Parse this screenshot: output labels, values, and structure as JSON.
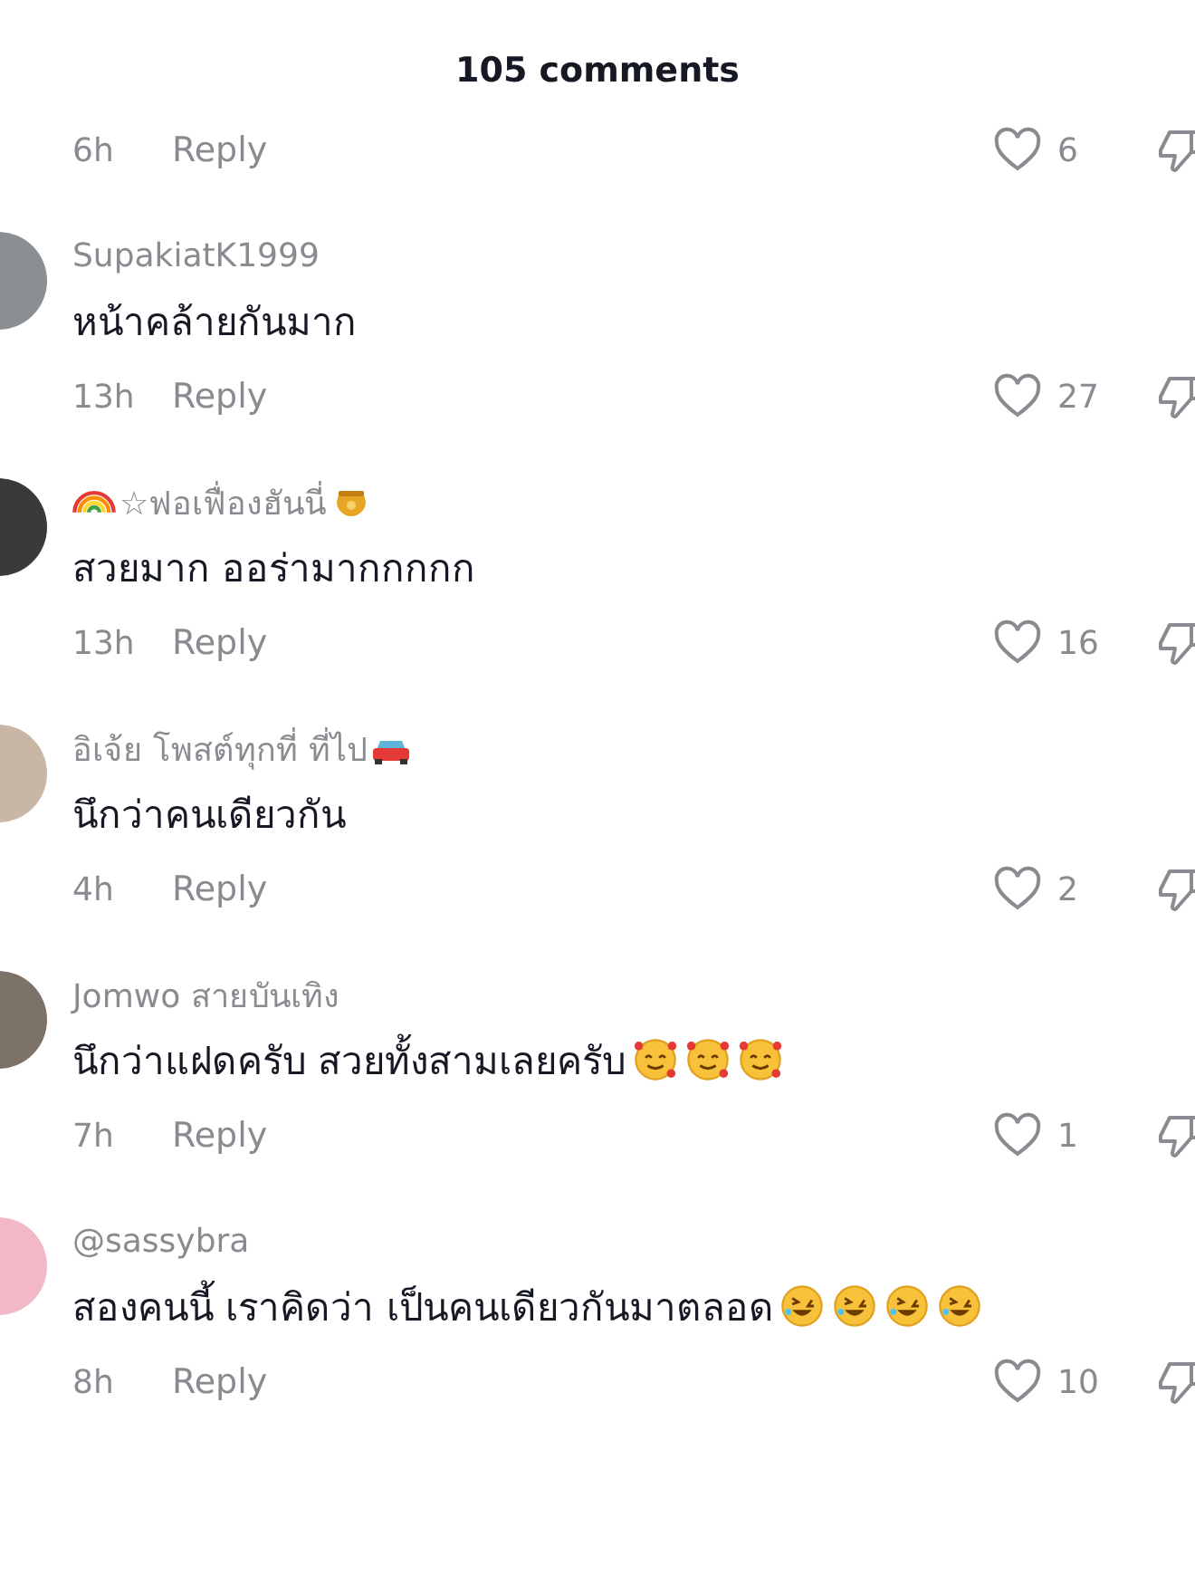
{
  "header": {
    "title": "105 comments"
  },
  "comments": [
    {
      "time": "6h",
      "reply": "Reply",
      "likes": "6"
    },
    {
      "avatar": {
        "color": "#8a8f94"
      },
      "name": "SupakiatK1999",
      "text": "หน้าคล้ายกันมาก",
      "time": "13h",
      "reply": "Reply",
      "likes": "27"
    },
    {
      "avatar": {
        "color": "#3a3a3a"
      },
      "name": "☆ฟอเฟื่องฮันนี่",
      "name_lead_emoji": [
        {
          "kind": "rainbow"
        }
      ],
      "name_emoji": [
        {
          "kind": "honey"
        }
      ],
      "text": "สวยมาก ออร่ามากกกกก",
      "time": "13h",
      "reply": "Reply",
      "likes": "16"
    },
    {
      "avatar": {
        "color": "#c9b6a4"
      },
      "name": "อิเจ้ย โพสต์ทุกที่ ที่ไป",
      "name_emoji": [
        {
          "kind": "car"
        }
      ],
      "text": "นึกว่าคนเดียวกัน",
      "time": "4h",
      "reply": "Reply",
      "likes": "2"
    },
    {
      "avatar": {
        "color": "#7d7268"
      },
      "name": "Jomwo สายบันเทิง",
      "text": "นึกว่าแฝดครับ สวยทั้งสามเลยครับ",
      "text_emoji": [
        {
          "kind": "hearts"
        },
        {
          "kind": "hearts"
        },
        {
          "kind": "hearts"
        }
      ],
      "time": "7h",
      "reply": "Reply",
      "likes": "1"
    },
    {
      "avatar": {
        "color": "#f2b8c6"
      },
      "name": "@sassybra",
      "text": "สองคนนี้ เราคิดว่า เป็นคนเดียวกันมาตลอด",
      "text_emoji": [
        {
          "kind": "laugh"
        },
        {
          "kind": "laugh"
        },
        {
          "kind": "laugh"
        },
        {
          "kind": "laugh"
        }
      ],
      "time": "8h",
      "reply": "Reply",
      "likes": "10"
    }
  ]
}
